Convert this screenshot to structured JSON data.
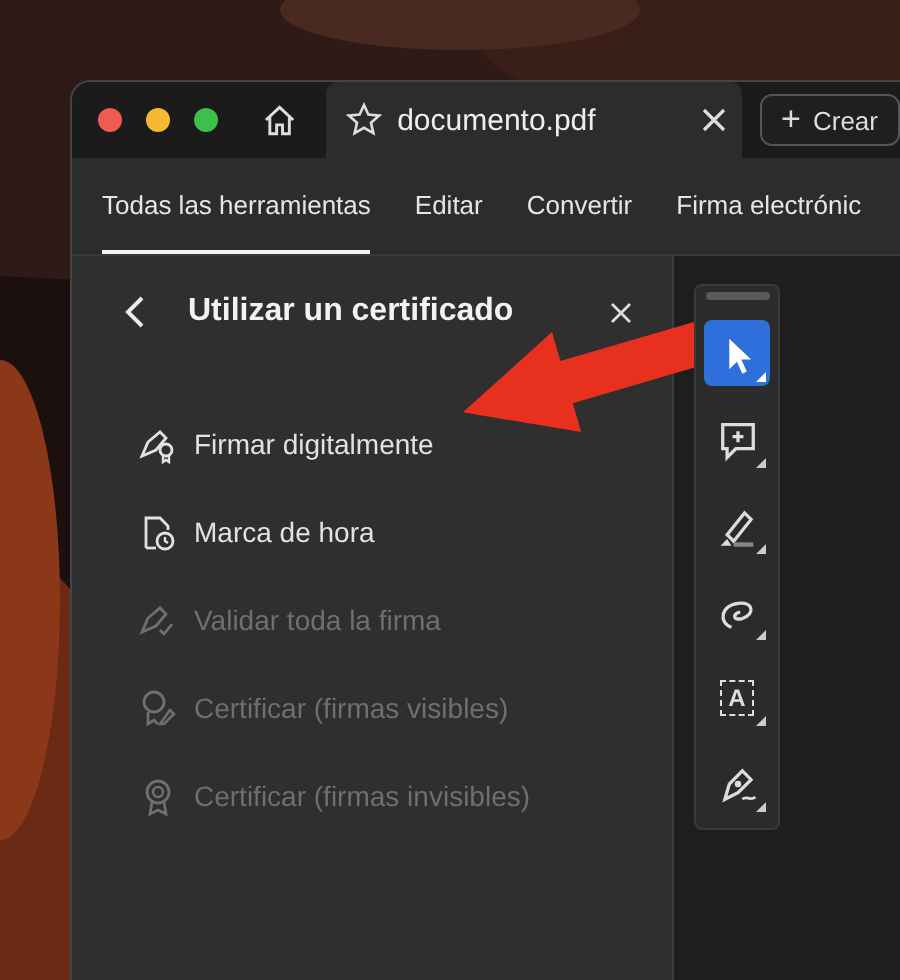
{
  "window": {
    "tab": {
      "title": "documento.pdf"
    },
    "create_button": {
      "icon": "+",
      "label": "Crear"
    }
  },
  "menu": [
    {
      "label": "Todas las herramientas",
      "selected": true
    },
    {
      "label": "Editar",
      "selected": false
    },
    {
      "label": "Convertir",
      "selected": false
    },
    {
      "label": "Firma electrónic",
      "selected": false
    }
  ],
  "panel": {
    "title": "Utilizar un certificado",
    "items": [
      {
        "kind": "sign",
        "label": "Firmar digitalmente",
        "disabled": false
      },
      {
        "kind": "timestamp",
        "label": "Marca de hora",
        "disabled": false
      },
      {
        "kind": "validate",
        "label": "Validar toda la firma",
        "disabled": true
      },
      {
        "kind": "certify-visible",
        "label": "Certificar (firmas visibles)",
        "disabled": true
      },
      {
        "kind": "certify-invisible",
        "label": "Certificar (firmas invisibles)",
        "disabled": true
      }
    ]
  },
  "tools": [
    {
      "kind": "select",
      "selected": true
    },
    {
      "kind": "comment",
      "selected": false
    },
    {
      "kind": "highlight",
      "selected": false
    },
    {
      "kind": "draw",
      "selected": false
    },
    {
      "kind": "text",
      "label": "A",
      "selected": false
    },
    {
      "kind": "sign",
      "selected": false
    }
  ]
}
